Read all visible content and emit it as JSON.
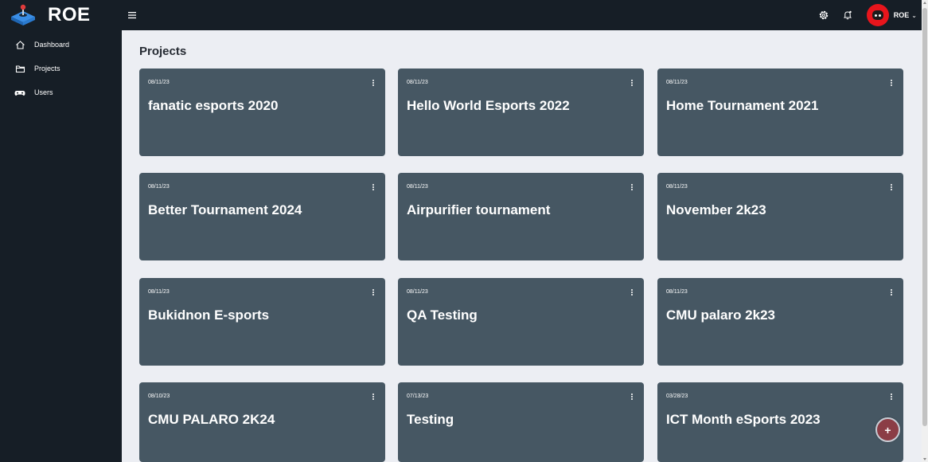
{
  "app": {
    "name": "ROE"
  },
  "header": {
    "user_label": "ROE",
    "icons": [
      "menu-icon",
      "settings-icon",
      "bell-icon",
      "avatar",
      "chevron-down-icon"
    ]
  },
  "sidebar": {
    "items": [
      {
        "label": "Dashboard",
        "icon": "home-icon"
      },
      {
        "label": "Projects",
        "icon": "folder-icon"
      },
      {
        "label": "Users",
        "icon": "gamepad-icon"
      }
    ]
  },
  "main": {
    "title": "Projects",
    "cards": [
      {
        "date": "08/11/23",
        "title": "fanatic esports 2020"
      },
      {
        "date": "08/11/23",
        "title": "Hello World Esports 2022"
      },
      {
        "date": "08/11/23",
        "title": "Home Tournament 2021"
      },
      {
        "date": "08/11/23",
        "title": "Better Tournament 2024"
      },
      {
        "date": "08/11/23",
        "title": "Airpurifier tournament"
      },
      {
        "date": "08/11/23",
        "title": "November 2k23"
      },
      {
        "date": "08/11/23",
        "title": "Bukidnon E-sports"
      },
      {
        "date": "08/11/23",
        "title": "QA Testing"
      },
      {
        "date": "08/11/23",
        "title": "CMU palaro 2k23"
      },
      {
        "date": "08/10/23",
        "title": "CMU PALARO 2K24"
      },
      {
        "date": "07/13/23",
        "title": "Testing"
      },
      {
        "date": "03/28/23",
        "title": "ICT Month eSports 2023"
      }
    ]
  },
  "fab": {
    "label": "+"
  },
  "colors": {
    "topbar": "#161e26",
    "sidebar": "#161e26",
    "background": "#eceef3",
    "card": "#465763",
    "avatar": "#e8151c",
    "fab": "#8b3d46",
    "logo_blue": "#3a8ee6",
    "logo_red": "#e03b3b"
  }
}
